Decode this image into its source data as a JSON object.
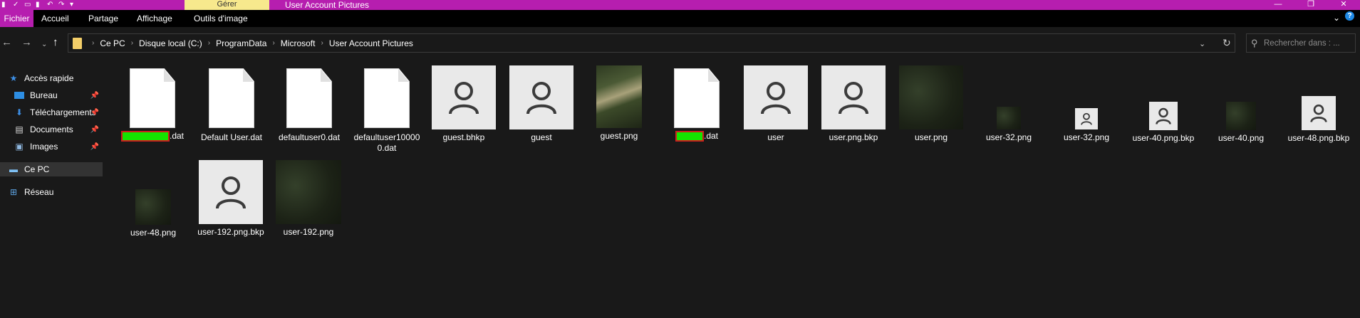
{
  "window": {
    "title": "User Account Pictures",
    "contextual_tab": "Gérer",
    "buttons": {
      "minimize": "—",
      "maximize": "❐",
      "close": "✕"
    }
  },
  "ribbon": {
    "tabs": [
      "Fichier",
      "Accueil",
      "Partage",
      "Affichage",
      "Outils d'image"
    ]
  },
  "address": {
    "crumbs": [
      "Ce PC",
      "Disque local (C:)",
      "ProgramData",
      "Microsoft",
      "User Account Pictures"
    ]
  },
  "search": {
    "placeholder": "Rechercher dans : ..."
  },
  "sidebar": {
    "items": [
      {
        "label": "Accès rapide",
        "icon": "star-icon"
      },
      {
        "label": "Bureau",
        "icon": "desktop-icon"
      },
      {
        "label": "Téléchargements",
        "icon": "download-icon"
      },
      {
        "label": "Documents",
        "icon": "documents-icon"
      },
      {
        "label": "Images",
        "icon": "images-icon"
      },
      {
        "label": "Ce PC",
        "icon": "computer-icon"
      },
      {
        "label": "Réseau",
        "icon": "network-icon"
      }
    ]
  },
  "files": [
    {
      "name": ".dat",
      "kind": "doc"
    },
    {
      "name": "Default User.dat",
      "kind": "doc"
    },
    {
      "name": "defaultuser0.dat",
      "kind": "doc"
    },
    {
      "name": "defaultuser100000.dat",
      "kind": "doc"
    },
    {
      "name": "guest.bhkp",
      "kind": "avatar"
    },
    {
      "name": "guest",
      "kind": "avatar"
    },
    {
      "name": "guest.png",
      "kind": "photo"
    },
    {
      "name": ".dat",
      "kind": "doc"
    },
    {
      "name": "user",
      "kind": "avatar"
    },
    {
      "name": "user.png.bkp",
      "kind": "avatar"
    },
    {
      "name": "user.png",
      "kind": "dark"
    },
    {
      "name": "user-32.png",
      "kind": "dark"
    },
    {
      "name": "user-32.png",
      "kind": "avatar"
    },
    {
      "name": "user-40.png.bkp",
      "kind": "avatar"
    },
    {
      "name": "user-40.png",
      "kind": "dark"
    },
    {
      "name": "user-48.png.bkp",
      "kind": "avatar"
    },
    {
      "name": "user-48.png",
      "kind": "dark"
    },
    {
      "name": "user-192.png.bkp",
      "kind": "avatar"
    },
    {
      "name": "user-192.png",
      "kind": "dark"
    }
  ],
  "colors": {
    "titlebar": "#b61eaf",
    "contextual_tab": "#f7e98d",
    "background": "#191919",
    "redaction_fill": "#15e400",
    "redaction_border": "#cf1f1f"
  }
}
